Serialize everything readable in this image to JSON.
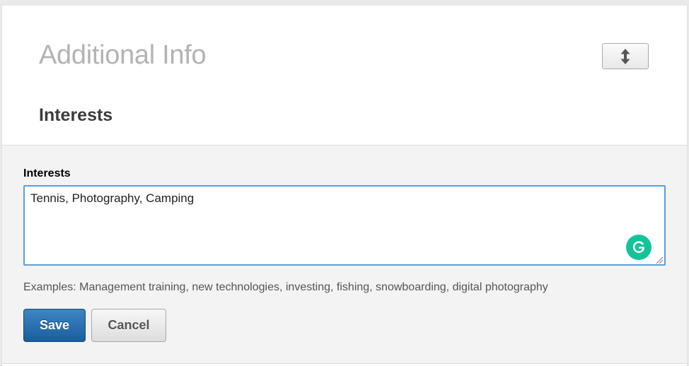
{
  "header": {
    "title": "Additional Info",
    "reorder_icon": "up-down-arrow-icon"
  },
  "section": {
    "title": "Interests"
  },
  "form": {
    "field_label": "Interests",
    "field_value": "Tennis, Photography, Camping",
    "grammarly_icon": "grammarly-g-icon",
    "hint": "Examples: Management training, new technologies, investing, fishing, snowboarding, digital photography",
    "save_label": "Save",
    "cancel_label": "Cancel"
  },
  "colors": {
    "title_gray": "#b3b3b3",
    "focus_blue": "#5b9dd9",
    "save_blue": "#1a5e9c",
    "grammarly_green": "#15c39a",
    "panel_bg": "#f3f3f3"
  }
}
